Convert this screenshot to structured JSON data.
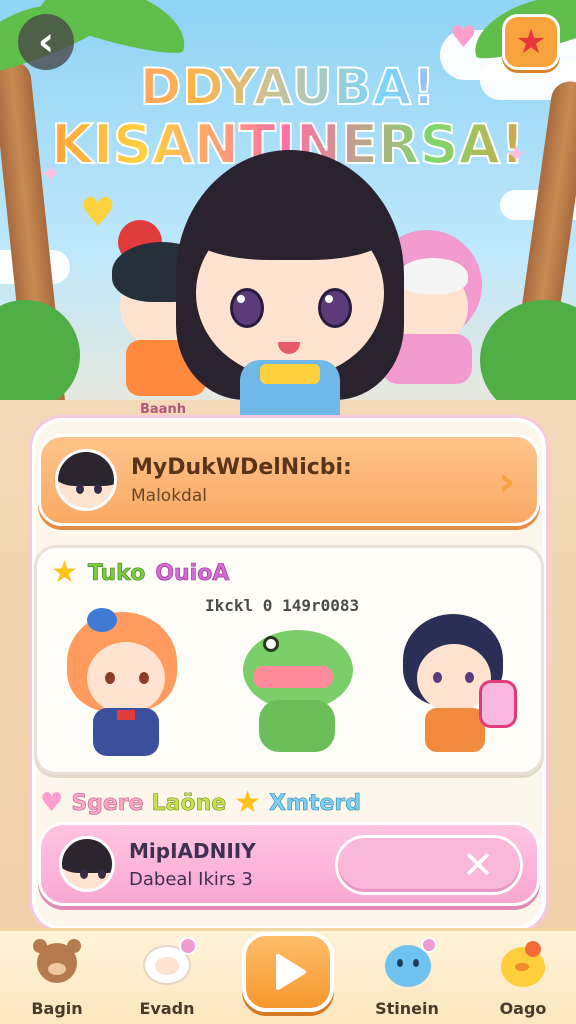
{
  "header": {
    "back_icon": "chevron-left-icon",
    "favorite_icon": "star-icon",
    "title_line1": "DDYAUBA!",
    "title_line2": "KISANTINERSA!"
  },
  "hero": {
    "caption": "Baanh"
  },
  "profile_card": {
    "title": "MyDukWDelNicbi:",
    "subtitle": "Malokdal",
    "arrow_icon": "chevron-right-icon"
  },
  "characters_box": {
    "label_green": "Tuko",
    "label_pink": "OuioA",
    "stat": "Ikckl 0 149r0083",
    "characters": [
      "orange-hair-girl",
      "green-dinosaur",
      "dark-hair-girl"
    ]
  },
  "section": {
    "label_pink": "Sgere",
    "label_green": "Laöne",
    "label_blue": "Xmterd"
  },
  "friend_card": {
    "title": "MipIADNIIY",
    "subtitle": "Dabeal Ikirs 3",
    "close_icon": "close-icon"
  },
  "bottom_nav": {
    "items": [
      {
        "label": "Bagin",
        "icon": "bear-icon"
      },
      {
        "label": "Evadn",
        "icon": "sheep-icon"
      },
      {
        "label": "Stinein",
        "icon": "blob-icon"
      },
      {
        "label": "Oago",
        "icon": "chick-icon"
      }
    ],
    "play_icon": "play-icon"
  },
  "colors": {
    "accent_orange": "#f9a965",
    "accent_pink": "#f9a8d2",
    "panel": "#fdf6ea"
  }
}
